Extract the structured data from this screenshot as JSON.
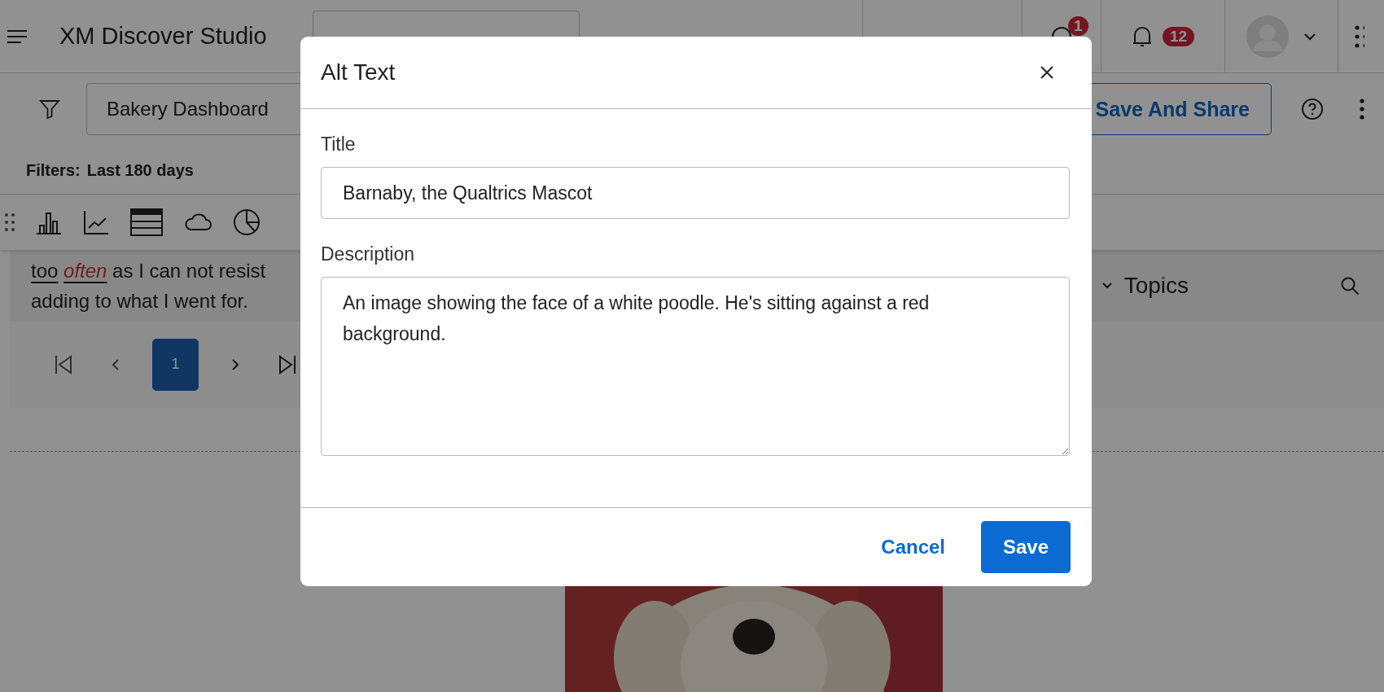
{
  "top_bar": {
    "app_title": "XM Discover Studio",
    "info_badge": "1",
    "notification_badge": "12"
  },
  "dashboard_bar": {
    "dashboard_name": "Bakery Dashboard",
    "share_button": "Save And Share",
    "filters_label": "Filters:",
    "filters_value": "Last 180 days"
  },
  "feed": {
    "segments": [
      {
        "text": "too",
        "kind": "underlined"
      },
      {
        "text": "often",
        "kind": "highlighted"
      },
      {
        "text": "as I can not resist adding to what I went for.",
        "kind": "plain"
      }
    ]
  },
  "topics_panel": {
    "title": "Topics"
  },
  "pagination": {
    "pages": [
      {
        "label": "1",
        "selected": true
      }
    ]
  },
  "modal": {
    "title": "Alt Text",
    "fields": [
      {
        "label": "Title",
        "kind": "input",
        "value": "Barnaby, the Qualtrics Mascot"
      },
      {
        "label": "Description",
        "kind": "textarea",
        "value": "An image showing the face of a white poodle. He's sitting against a red background."
      }
    ],
    "buttons": [
      {
        "label": "Cancel",
        "kind": "secondary"
      },
      {
        "label": "Save",
        "kind": "primary"
      }
    ]
  }
}
